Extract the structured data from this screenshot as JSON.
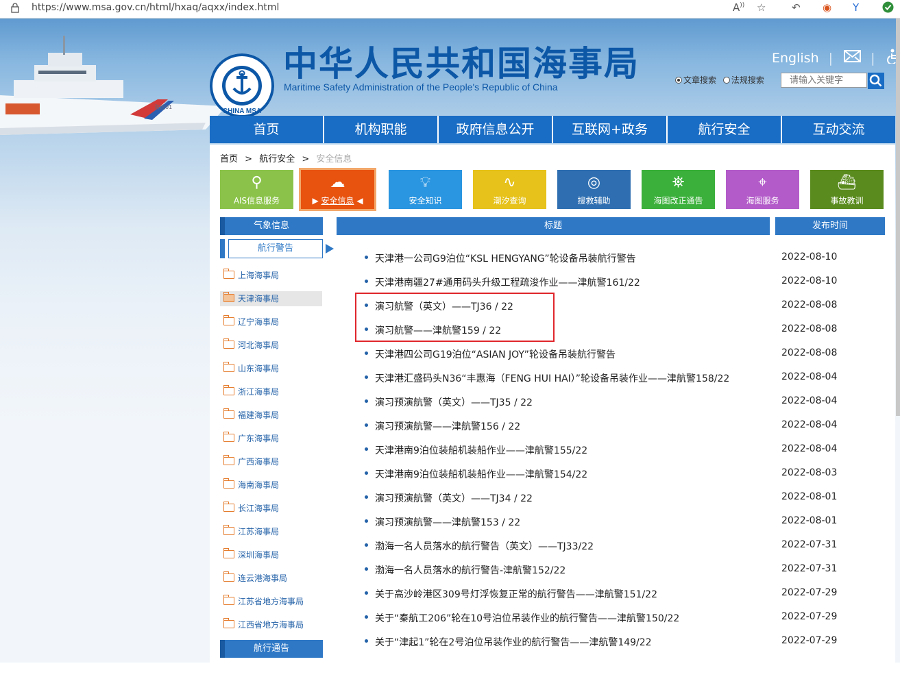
{
  "browser": {
    "url": "https://www.msa.gov.cn/html/hxaq/aqxx/index.html",
    "icons": [
      "lock-icon",
      "read-aloud-icon",
      "favorite-icon",
      "back-icon",
      "extension-icon",
      "extension-icon",
      "profile-icon"
    ]
  },
  "header": {
    "logo_text": "CHINA MSA",
    "title_cn": "中华人民共和国海事局",
    "title_en": "Maritime Safety Administration of the People's Republic of China",
    "english_link": "English",
    "search": {
      "option1": "文章搜索",
      "option2": "法规搜索",
      "placeholder": "请输入关键字"
    }
  },
  "nav": [
    "首页",
    "机构职能",
    "政府信息公开",
    "互联网+政务",
    "航行安全",
    "互动交流"
  ],
  "breadcrumb": {
    "home": "首页",
    "sep": ">",
    "level2": "航行安全",
    "current": "安全信息"
  },
  "tiles": [
    {
      "label": "AIS信息服务",
      "color": "#8bc34a"
    },
    {
      "label": "安全信息",
      "color": "#e8530f"
    },
    {
      "label": "安全知识",
      "color": "#2a95e0"
    },
    {
      "label": "潮汐查询",
      "color": "#e6c21a"
    },
    {
      "label": "搜救辅助",
      "color": "#2f6fb1"
    },
    {
      "label": "海图改正通告",
      "color": "#3bb03b"
    },
    {
      "label": "海图服务",
      "color": "#b35bc9"
    },
    {
      "label": "事故教训",
      "color": "#5a8b1e"
    }
  ],
  "sidebar": {
    "heading1": "气象信息",
    "heading2": "航行警告",
    "heading3": "航行通告",
    "items": [
      "上海海事局",
      "天津海事局",
      "辽宁海事局",
      "河北海事局",
      "山东海事局",
      "浙江海事局",
      "福建海事局",
      "广东海事局",
      "广西海事局",
      "海南海事局",
      "长江海事局",
      "江苏海事局",
      "深圳海事局",
      "连云港海事局",
      "江苏省地方海事局",
      "江西省地方海事局"
    ]
  },
  "table": {
    "col_title": "标题",
    "col_date": "发布时间",
    "rows": [
      {
        "title": "天津港一公司G9泊位“KSL HENGYANG”轮设备吊装航行警告",
        "date": "2022-08-10"
      },
      {
        "title": "天津港南疆27#通用码头升级工程疏浚作业——津航警161/22",
        "date": "2022-08-10"
      },
      {
        "title": "演习航警（英文）——TJ36 / 22",
        "date": "2022-08-08"
      },
      {
        "title": "演习航警——津航警159 / 22",
        "date": "2022-08-08"
      },
      {
        "title": "天津港四公司G19泊位“ASIAN JOY”轮设备吊装航行警告",
        "date": "2022-08-08"
      },
      {
        "title": "天津港汇盛码头N36“丰惠海（FENG HUI HAI）”轮设备吊装作业——津航警158/22",
        "date": "2022-08-04"
      },
      {
        "title": "演习预演航警（英文）——TJ35 / 22",
        "date": "2022-08-04"
      },
      {
        "title": "演习预演航警——津航警156 / 22",
        "date": "2022-08-04"
      },
      {
        "title": "天津港南9泊位装船机装船作业——津航警155/22",
        "date": "2022-08-04"
      },
      {
        "title": "天津港南9泊位装船机装船作业——津航警154/22",
        "date": "2022-08-03"
      },
      {
        "title": "演习预演航警（英文）——TJ34 / 22",
        "date": "2022-08-01"
      },
      {
        "title": "演习预演航警——津航警153 / 22",
        "date": "2022-08-01"
      },
      {
        "title": "渤海一名人员落水的航行警告（英文）——TJ33/22",
        "date": "2022-07-31"
      },
      {
        "title": "渤海一名人员落水的航行警告-津航警152/22",
        "date": "2022-07-31"
      },
      {
        "title": "关于高沙岭港区309号灯浮恢复正常的航行警告——津航警151/22",
        "date": "2022-07-29"
      },
      {
        "title": "关于“秦航工206”轮在10号泊位吊装作业的航行警告——津航警150/22",
        "date": "2022-07-29"
      },
      {
        "title": "关于“津起1”轮在2号泊位吊装作业的航行警告——津航警149/22",
        "date": "2022-07-29"
      }
    ]
  }
}
